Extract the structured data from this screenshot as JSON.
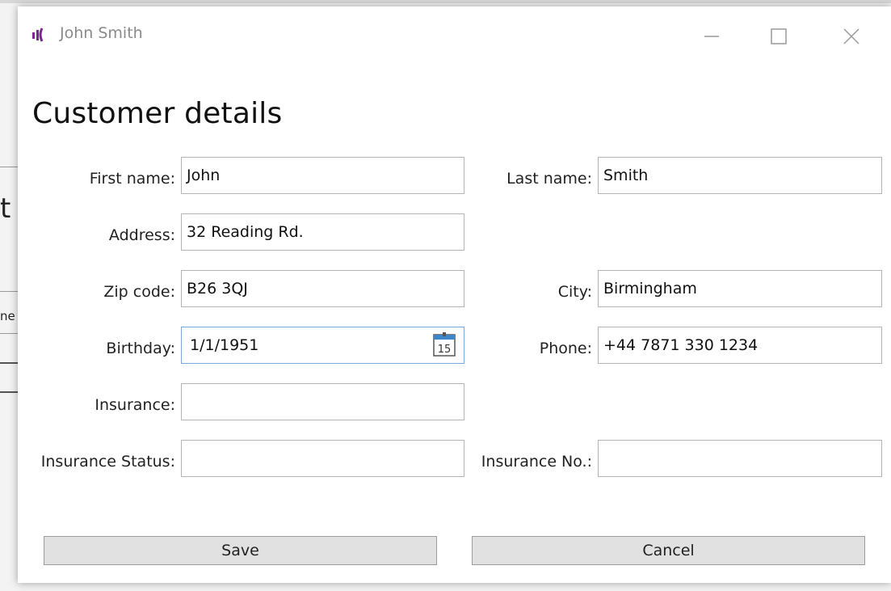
{
  "window": {
    "title": "John Smith"
  },
  "page_title": "Customer details",
  "form": {
    "first_name": {
      "label": "First name:",
      "value": "John"
    },
    "last_name": {
      "label": "Last name:",
      "value": "Smith"
    },
    "address": {
      "label": "Address:",
      "value": "32 Reading Rd."
    },
    "zip_code": {
      "label": "Zip code:",
      "value": "B26 3QJ"
    },
    "city": {
      "label": "City:",
      "value": "Birmingham"
    },
    "birthday": {
      "label": "Birthday:",
      "value": "1/1/1951",
      "calendar_day": "15"
    },
    "phone": {
      "label": "Phone:",
      "value": "+44 7871 330 1234"
    },
    "insurance": {
      "label": "Insurance:",
      "value": ""
    },
    "insurance_status": {
      "label": "Insurance Status:",
      "value": ""
    },
    "insurance_no": {
      "label": "Insurance No.:",
      "value": ""
    }
  },
  "buttons": {
    "save": "Save",
    "cancel": "Cancel"
  },
  "icons": {
    "app": "app-logo-icon",
    "minimize": "minimize-icon",
    "maximize": "maximize-icon",
    "close": "close-icon",
    "calendar": "calendar-icon"
  },
  "background": {
    "fragment_1": "t",
    "fragment_2": "ne"
  },
  "colors": {
    "app_icon": "#7a2a8c",
    "date_border": "#7aa7d6",
    "button_bg": "#e1e1e1"
  }
}
